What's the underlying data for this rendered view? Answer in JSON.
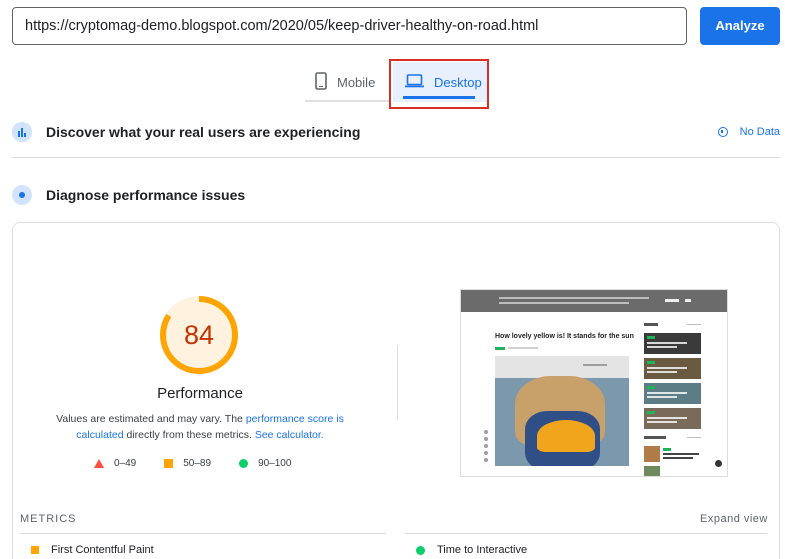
{
  "url_input": {
    "value": "https://cryptomag-demo.blogspot.com/2020/05/keep-driver-healthy-on-road.html"
  },
  "analyze_button": {
    "label": "Analyze"
  },
  "tabs": [
    {
      "label": "Mobile",
      "icon": "phone-icon",
      "selected": false
    },
    {
      "label": "Desktop",
      "icon": "laptop-icon",
      "selected": true
    }
  ],
  "field_data": {
    "title": "Discover what your real users are experiencing",
    "status": "No Data"
  },
  "diagnose": {
    "title": "Diagnose performance issues"
  },
  "score": {
    "value": 84,
    "label": "Performance",
    "fraction": 0.84,
    "color": "#ffa400",
    "text_color": "#c33300",
    "desc_before": "Values are estimated and may vary. The ",
    "desc_link1": "performance score is calculated",
    "desc_middle": " directly from these metrics. ",
    "desc_link2": "See calculator."
  },
  "legend": [
    {
      "shape": "triangle",
      "color": "#ff4e42",
      "range": "0–49"
    },
    {
      "shape": "square",
      "color": "#ffa400",
      "range": "50–89"
    },
    {
      "shape": "circle",
      "color": "#0cce6b",
      "range": "90–100"
    }
  ],
  "screenshot": {
    "post_title": "How lovely yellow is! It stands for the sun"
  },
  "metrics": {
    "heading": "METRICS",
    "expand_label": "Expand view",
    "items": [
      {
        "name": "First Contentful Paint",
        "status": "average",
        "color": "#ffa400"
      },
      {
        "name": "Time to Interactive",
        "status": "good",
        "color": "#0cce6b"
      }
    ]
  }
}
